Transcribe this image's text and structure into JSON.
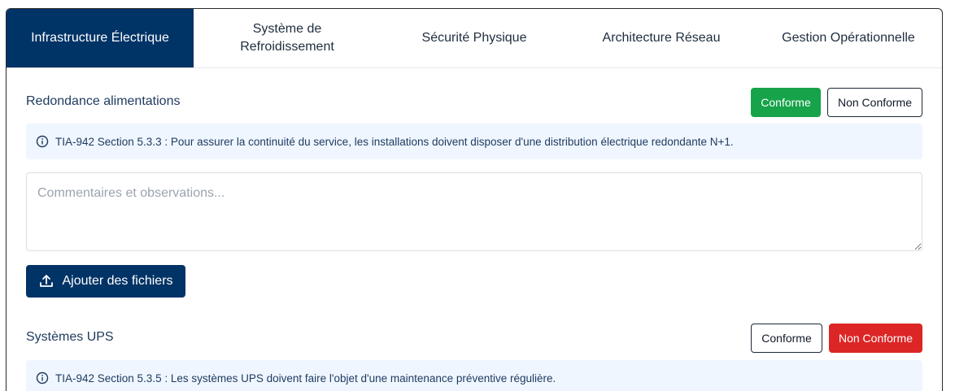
{
  "tabs": [
    {
      "label": "Infrastructure Électrique",
      "active": true
    },
    {
      "label": "Système de Refroidissement",
      "active": false
    },
    {
      "label": "Sécurité Physique",
      "active": false
    },
    {
      "label": "Architecture Réseau",
      "active": false
    },
    {
      "label": "Gestion Opérationnelle",
      "active": false
    }
  ],
  "sections": [
    {
      "title": "Redondance alimentations",
      "conforme_label": "Conforme",
      "non_conforme_label": "Non Conforme",
      "selected": "conforme",
      "info": "TIA-942 Section 5.3.3 : Pour assurer la continuité du service, les installations doivent disposer d'une distribution électrique redondante N+1.",
      "comment_placeholder": "Commentaires et observations...",
      "upload_label": "Ajouter des fichiers"
    },
    {
      "title": "Systèmes UPS",
      "conforme_label": "Conforme",
      "non_conforme_label": "Non Conforme",
      "selected": "non_conforme",
      "info": "TIA-942 Section 5.3.5 : Les systèmes UPS doivent faire l'objet d'une maintenance préventive régulière."
    }
  ],
  "colors": {
    "primary": "#003366",
    "conforme": "#16a34a",
    "non_conforme": "#dc2626",
    "info_bg": "#eff6ff"
  },
  "icons": {
    "info": "info-circle-icon",
    "upload": "upload-icon"
  }
}
